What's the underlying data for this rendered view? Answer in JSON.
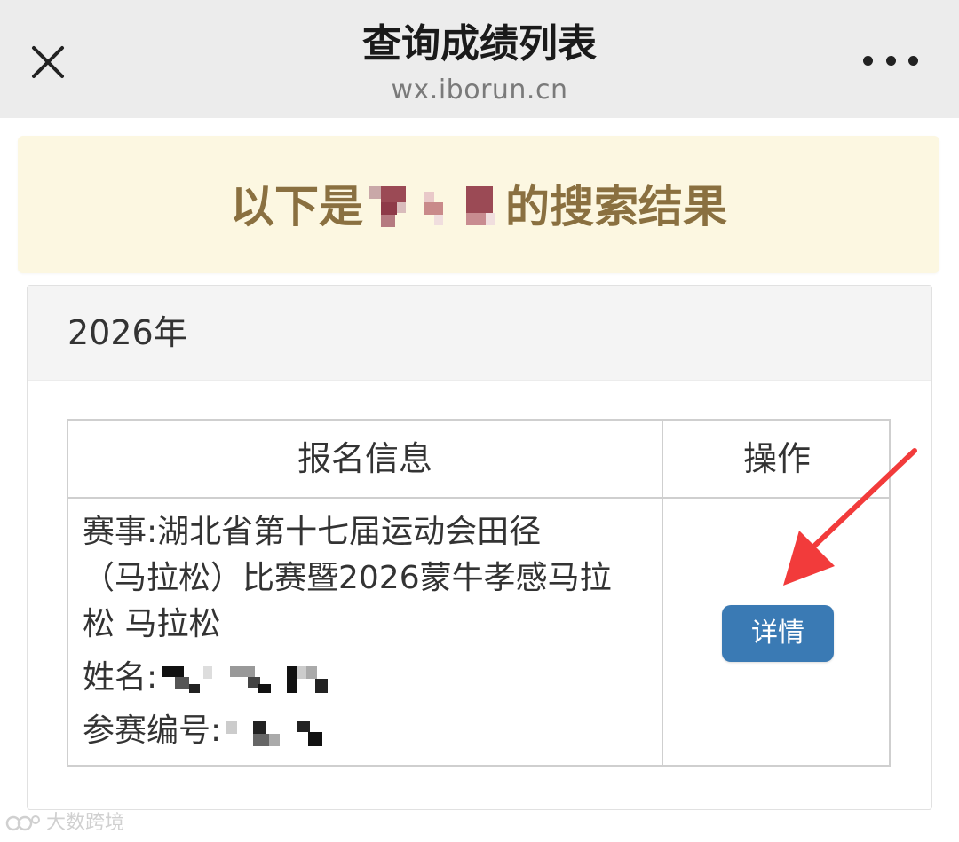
{
  "header": {
    "title": "查询成绩列表",
    "subtitle": "wx.iborun.cn",
    "close_icon": "close-icon",
    "more_icon": "more-dots-icon"
  },
  "banner": {
    "prefix": "以下是",
    "suffix": "的搜索结果"
  },
  "card": {
    "year": "2026年",
    "table": {
      "headers": [
        "报名信息",
        "操作"
      ],
      "row": {
        "event_line1": "赛事:湖北省第十七届运动会田径",
        "event_line2": "（马拉松）比赛暨2026蒙牛孝感马拉",
        "event_line3": "松 马拉松",
        "name_label": "姓名:",
        "bib_label": "参赛编号:",
        "detail_button": "详情"
      }
    }
  },
  "watermark": {
    "text": "大数跨境"
  },
  "colors": {
    "header_bg": "#ececec",
    "banner_bg": "#fcf7e1",
    "banner_text": "#8a7040",
    "button": "#3a7ab4",
    "arrow": "#f23b3b"
  }
}
